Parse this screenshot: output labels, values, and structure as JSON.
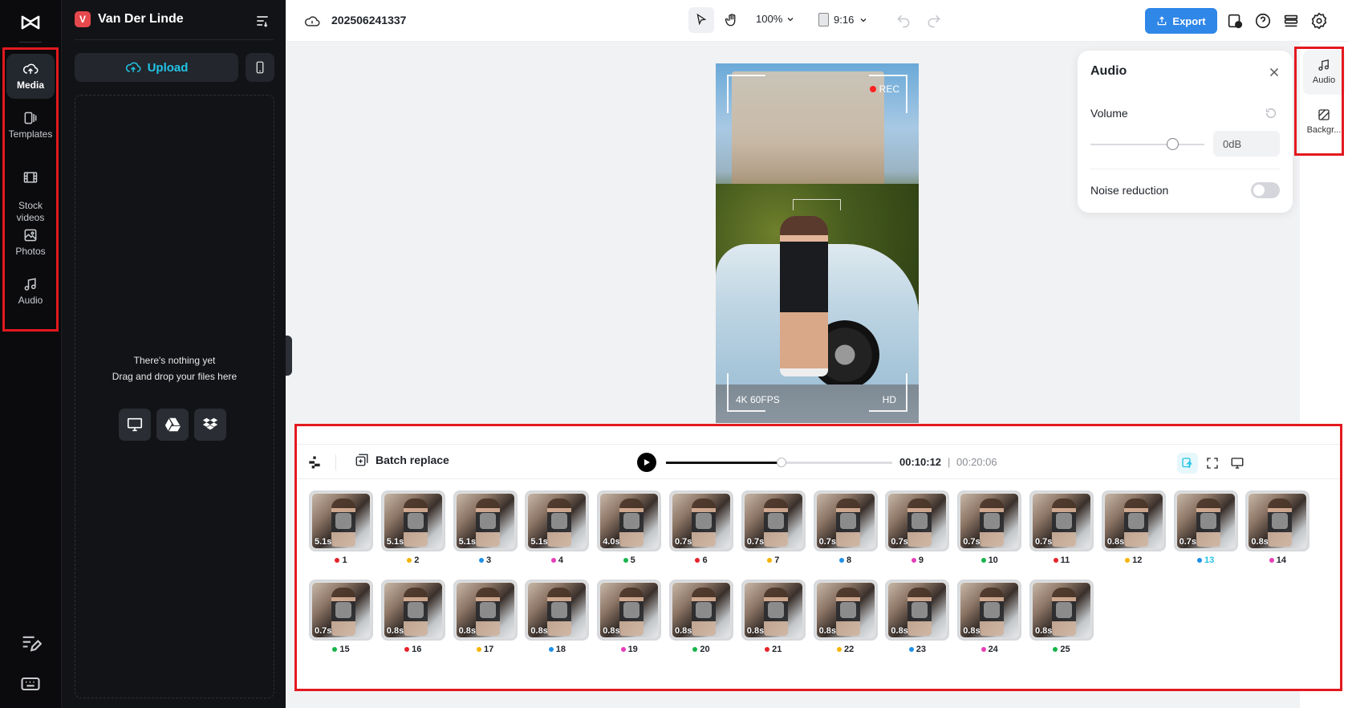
{
  "rail": {
    "items": [
      {
        "key": "media",
        "label": "Media"
      },
      {
        "key": "templates",
        "label": "Templates"
      },
      {
        "key": "stock",
        "label": "Stock\nvideos"
      },
      {
        "key": "photos",
        "label": "Photos"
      },
      {
        "key": "audio",
        "label": "Audio"
      }
    ]
  },
  "panel": {
    "avatar_letter": "V",
    "project_name": "Van Der Linde",
    "upload_label": "Upload",
    "empty_line1": "There's nothing yet",
    "empty_line2": "Drag and drop your files here"
  },
  "topbar": {
    "file_name": "202506241337",
    "zoom": "100%",
    "ratio": "9:16",
    "export_label": "Export"
  },
  "preview": {
    "rec_label": "REC",
    "fps_label": "4K 60FPS",
    "hd_label": "HD"
  },
  "audio_panel": {
    "title": "Audio",
    "volume_label": "Volume",
    "volume_value": "0dB",
    "volume_level": 0.72,
    "noise_label": "Noise reduction",
    "noise_enabled": false
  },
  "right_rail": {
    "items": [
      {
        "label": "Audio"
      },
      {
        "label": "Backgr..."
      }
    ]
  },
  "timeline": {
    "batch_label": "Batch replace",
    "current_time": "00:10:12",
    "separator": "|",
    "total_time": "00:20:06",
    "progress": 0.51,
    "clips": [
      {
        "n": "1",
        "dur": "5.1s",
        "dot": "#e5232a"
      },
      {
        "n": "2",
        "dur": "5.1s",
        "dot": "#f5b400"
      },
      {
        "n": "3",
        "dur": "5.1s",
        "dot": "#1e90e8"
      },
      {
        "n": "4",
        "dur": "5.1s",
        "dot": "#e83eb8"
      },
      {
        "n": "5",
        "dur": "4.0s",
        "dot": "#18b34a"
      },
      {
        "n": "6",
        "dur": "0.7s",
        "dot": "#e5232a"
      },
      {
        "n": "7",
        "dur": "0.7s",
        "dot": "#f5b400"
      },
      {
        "n": "8",
        "dur": "0.7s",
        "dot": "#1e90e8"
      },
      {
        "n": "9",
        "dur": "0.7s",
        "dot": "#e83eb8"
      },
      {
        "n": "10",
        "dur": "0.7s",
        "dot": "#18b34a"
      },
      {
        "n": "11",
        "dur": "0.7s",
        "dot": "#e5232a"
      },
      {
        "n": "12",
        "dur": "0.8s",
        "dot": "#f5b400"
      },
      {
        "n": "13",
        "dur": "0.7s",
        "dot": "#1e90e8",
        "highlight": true
      },
      {
        "n": "14",
        "dur": "0.8s",
        "dot": "#e83eb8"
      },
      {
        "n": "15",
        "dur": "0.7s",
        "dot": "#18b34a"
      },
      {
        "n": "16",
        "dur": "0.8s",
        "dot": "#e5232a"
      },
      {
        "n": "17",
        "dur": "0.8s",
        "dot": "#f5b400"
      },
      {
        "n": "18",
        "dur": "0.8s",
        "dot": "#1e90e8"
      },
      {
        "n": "19",
        "dur": "0.8s",
        "dot": "#e83eb8"
      },
      {
        "n": "20",
        "dur": "0.8s",
        "dot": "#18b34a"
      },
      {
        "n": "21",
        "dur": "0.8s",
        "dot": "#e5232a"
      },
      {
        "n": "22",
        "dur": "0.8s",
        "dot": "#f5b400"
      },
      {
        "n": "23",
        "dur": "0.8s",
        "dot": "#1e90e8"
      },
      {
        "n": "24",
        "dur": "0.8s",
        "dot": "#e83eb8"
      },
      {
        "n": "25",
        "dur": "0.8s",
        "dot": "#18b34a"
      }
    ]
  },
  "colors": {
    "accent": "#22c3e6",
    "export": "#2f87e8",
    "highlight_box": "#e3191f"
  }
}
